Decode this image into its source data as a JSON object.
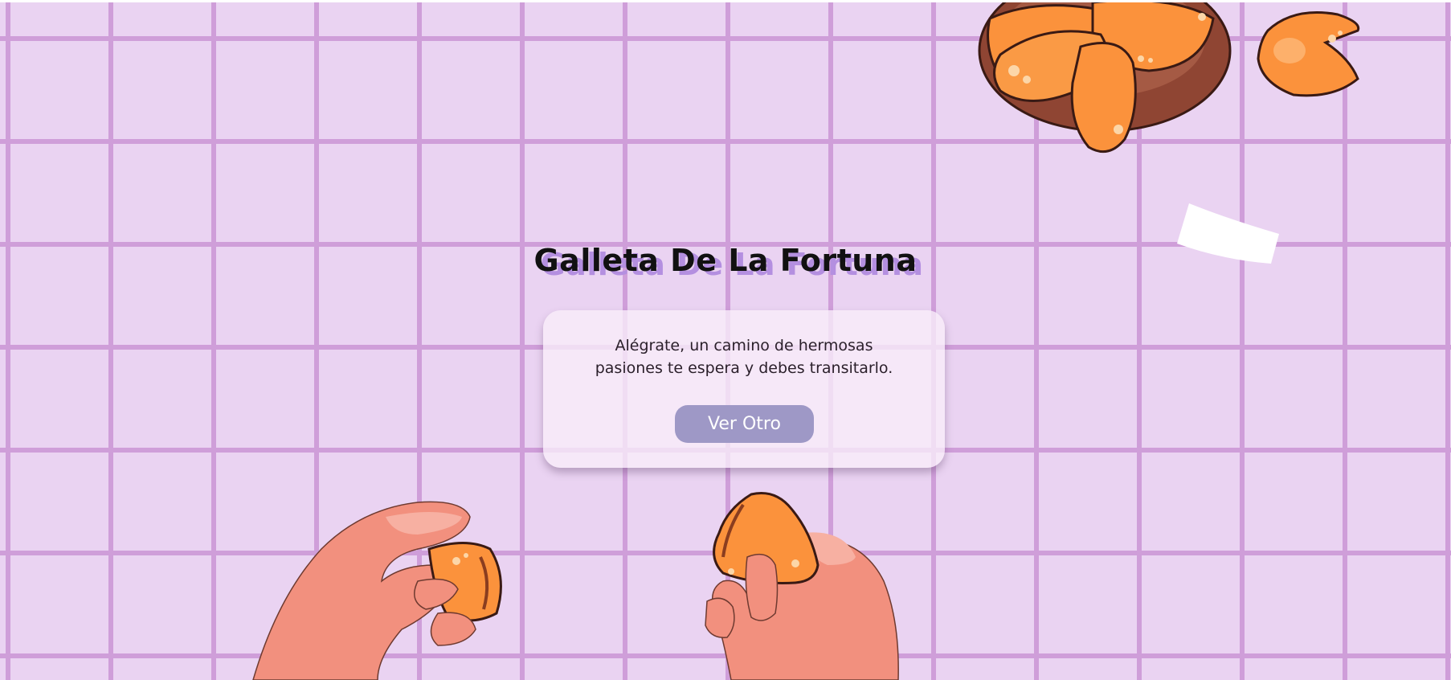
{
  "page": {
    "title": "Galleta De La Fortuna",
    "fortune": "Alégrate, un camino de hermosas pasiones te espera y debes transitarlo.",
    "button_label": "Ver Otro"
  },
  "colors": {
    "background": "#ead3f2",
    "grid_lines": "#cf9ed9",
    "title_shadow": "#b48fe0",
    "button": "#9e98c6",
    "cookie": "#fb923c",
    "skin": "#f2907e"
  },
  "icons": [
    "fortune-cookie-bowl",
    "fortune-cookie",
    "fortune-paper",
    "hands-breaking-cookie"
  ]
}
